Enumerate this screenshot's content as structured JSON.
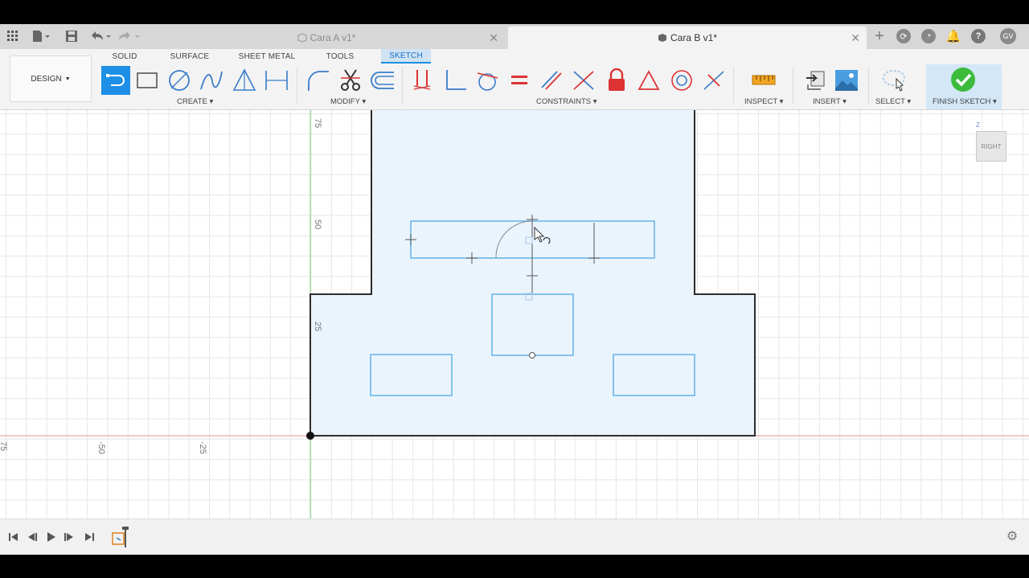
{
  "tabs": [
    {
      "label": "Cara A v1*",
      "active": false
    },
    {
      "label": "Cara B v1*",
      "active": true
    }
  ],
  "user_initials": "GV",
  "workspace": "DESIGN",
  "ribbon_tabs": [
    "SOLID",
    "SURFACE",
    "SHEET METAL",
    "TOOLS",
    "SKETCH"
  ],
  "groups": {
    "create": "CREATE",
    "modify": "MODIFY",
    "constraints": "CONSTRAINTS",
    "inspect": "INSPECT",
    "insert": "INSERT",
    "select": "SELECT",
    "finish": "FINISH SKETCH"
  },
  "axis_labels": {
    "v75": "75",
    "v50": "50",
    "v25": "25",
    "h_neg50": "-50",
    "h_neg25": "-25",
    "h_neg75": "75"
  },
  "viewcube": {
    "face": "RIGHT",
    "axis": "Z"
  },
  "colors": {
    "accent": "#1e8fe6",
    "finish_green": "#3dbb3d",
    "sketch_line": "#2c2c2c",
    "profile_fill": "#eaf4fd",
    "sketch_blue": "#5aaee6"
  }
}
